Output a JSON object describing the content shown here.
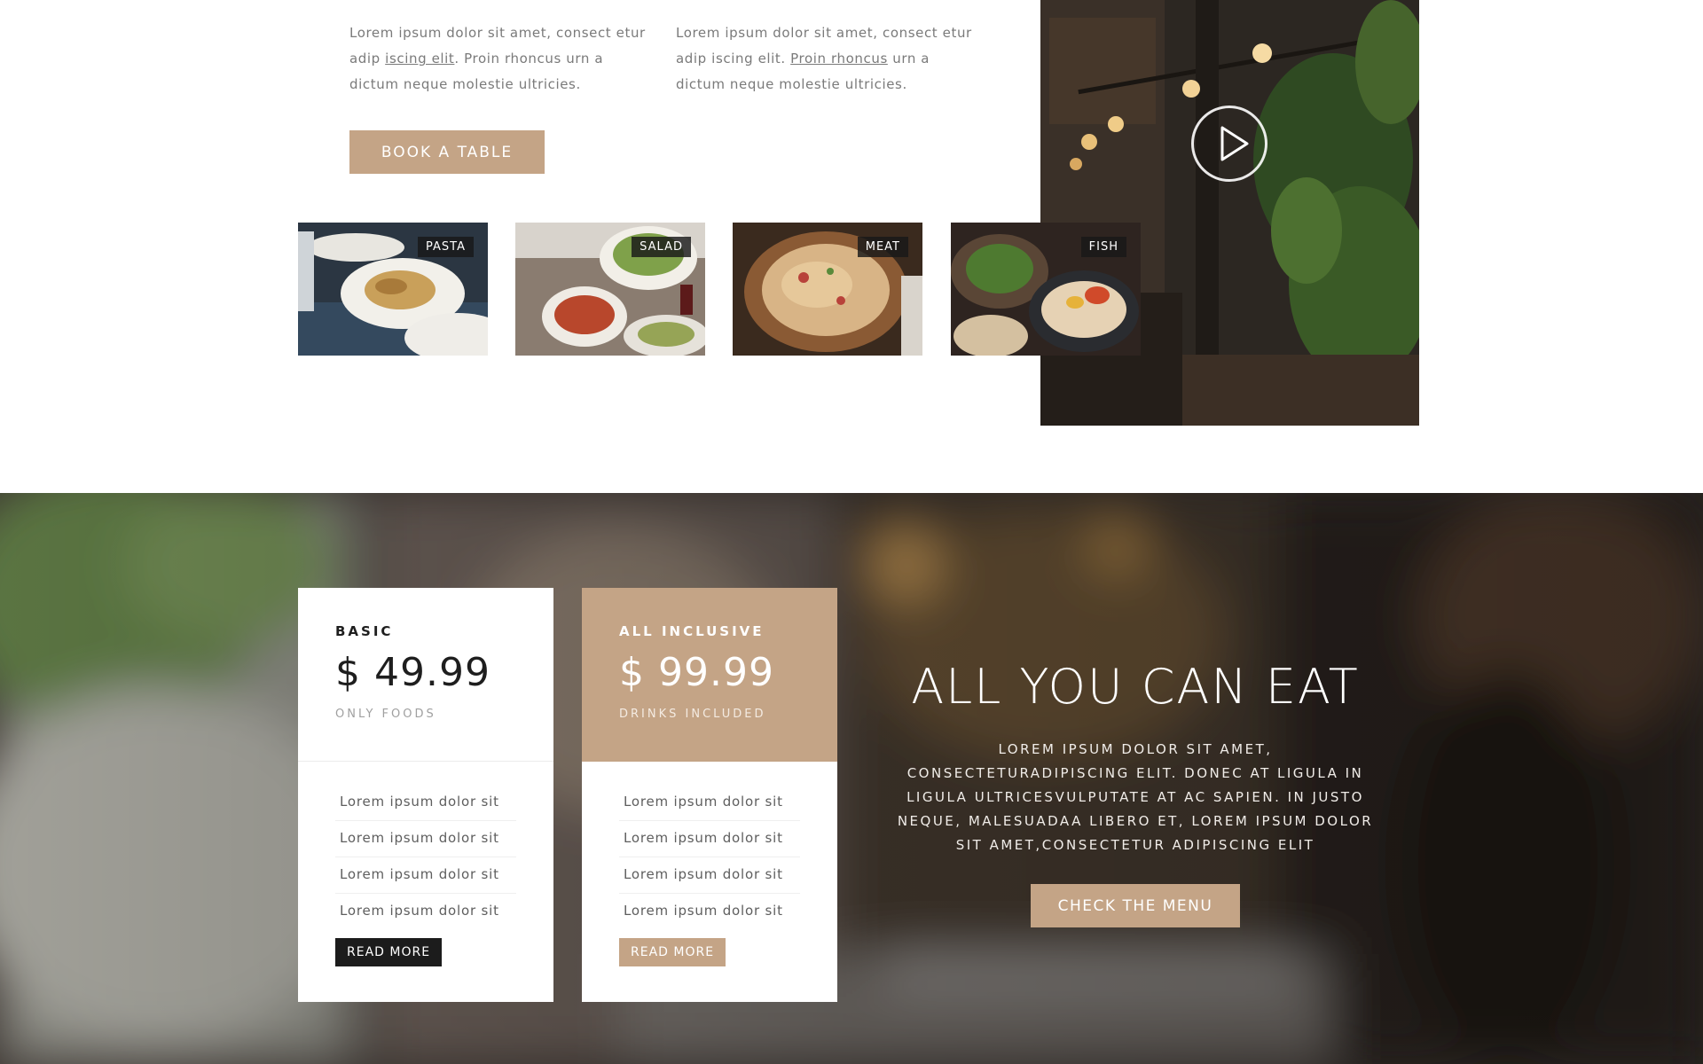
{
  "intro": {
    "col1": {
      "before": "Lorem ipsum dolor sit amet, consect etur adip ",
      "link": "iscing elit",
      "after": ". Proin rhoncus urn a dictum neque molestie ultricies."
    },
    "col2": {
      "before": "Lorem ipsum dolor sit amet, consect etur adip iscing elit. ",
      "link": "Proin rhoncus",
      "after": " urn a dictum neque molestie ultricies."
    },
    "book_label": "BOOK A TABLE"
  },
  "categories": [
    {
      "label": "PASTA"
    },
    {
      "label": "SALAD"
    },
    {
      "label": "MEAT"
    },
    {
      "label": "FISH"
    }
  ],
  "video": {
    "icon": "play-icon"
  },
  "plans": [
    {
      "name": "BASIC",
      "price": "$ 49.99",
      "note": "ONLY FOODS",
      "features": [
        "Lorem ipsum dolor sit",
        "Lorem ipsum dolor sit",
        "Lorem ipsum dolor sit",
        "Lorem ipsum dolor sit"
      ],
      "button": "READ MORE"
    },
    {
      "name": "ALL INCLUSIVE",
      "price": "$ 99.99",
      "note": "DRINKS INCLUDED",
      "features": [
        "Lorem ipsum dolor sit",
        "Lorem ipsum dolor sit",
        "Lorem ipsum dolor sit",
        "Lorem ipsum dolor sit"
      ],
      "button": "READ MORE"
    }
  ],
  "promo": {
    "title": "ALL YOU CAN EAT",
    "text": "LOREM IPSUM DOLOR SIT AMET, CONSECTETURADIPISCING ELIT. DONEC AT LIGULA IN LIGULA ULTRICESVULPUTATE AT AC SAPIEN. IN JUSTO NEQUE, MALESUADAA LIBERO ET, LOREM IPSUM DOLOR SIT AMET,CONSECTETUR ADIPISCING ELIT",
    "button": "CHECK THE MENU"
  },
  "colors": {
    "accent": "#c4a486",
    "dark": "#1c1c1c"
  }
}
